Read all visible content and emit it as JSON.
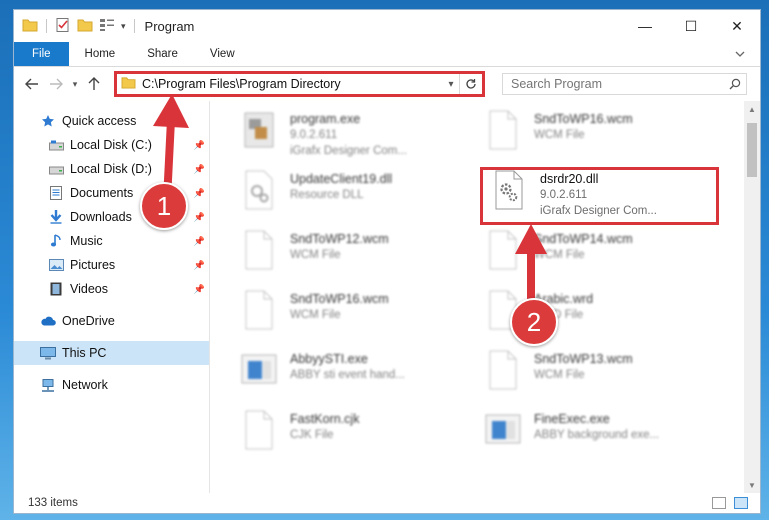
{
  "window": {
    "title": "Program",
    "controls": {
      "minimize": "—",
      "maximize": "☐",
      "close": "✕"
    }
  },
  "ribbon": {
    "tabs": [
      "File",
      "Home",
      "Share",
      "View"
    ],
    "help_icon": "chevron-down-icon"
  },
  "address": {
    "path": "C:\\Program Files\\Program Directory",
    "search_placeholder": "Search Program"
  },
  "sidebar": {
    "items": [
      {
        "label": "Quick access",
        "icon": "star-icon"
      },
      {
        "label": "Local Disk (C:)",
        "icon": "drive-icon",
        "pinned": true
      },
      {
        "label": "Local Disk (D:)",
        "icon": "drive-icon",
        "pinned": true
      },
      {
        "label": "Documents",
        "icon": "documents-icon",
        "pinned": true
      },
      {
        "label": "Downloads",
        "icon": "download-icon",
        "pinned": true
      },
      {
        "label": "Music",
        "icon": "music-icon",
        "pinned": true
      },
      {
        "label": "Pictures",
        "icon": "pictures-icon",
        "pinned": true
      },
      {
        "label": "Videos",
        "icon": "videos-icon",
        "pinned": true
      },
      {
        "label": "OneDrive",
        "icon": "cloud-icon"
      },
      {
        "label": "This PC",
        "icon": "computer-icon",
        "selected": true
      },
      {
        "label": "Network",
        "icon": "network-icon"
      }
    ]
  },
  "files": [
    {
      "name": "program.exe",
      "line2": "9.0.2.611",
      "line3": "iGrafx Designer Com...",
      "icon": "exe-icon"
    },
    {
      "name": "SndToWP16.wcm",
      "line2": "WCM File",
      "line3": "",
      "icon": "file-icon"
    },
    {
      "name": "UpdateClient19.dll",
      "line2": "Resource DLL",
      "line3": "",
      "icon": "dll-icon"
    },
    {
      "name": "dsrdr20.dll",
      "line2": "9.0.2.611",
      "line3": "iGrafx Designer Com...",
      "icon": "dll-gear-icon",
      "highlighted": true
    },
    {
      "name": "SndToWP12.wcm",
      "line2": "WCM File",
      "line3": "",
      "icon": "file-icon"
    },
    {
      "name": "SndToWP14.wcm",
      "line2": "WCM File",
      "line3": "",
      "icon": "file-icon"
    },
    {
      "name": "SndToWP16.wcm",
      "line2": "WCM File",
      "line3": "",
      "icon": "file-icon"
    },
    {
      "name": "Arabic.wrd",
      "line2": "WRD File",
      "line3": "",
      "icon": "file-icon"
    },
    {
      "name": "AbbyySTI.exe",
      "line2": "ABBY sti event hand...",
      "line3": "",
      "icon": "app-icon"
    },
    {
      "name": "SndToWP13.wcm",
      "line2": "WCM File",
      "line3": "",
      "icon": "file-icon"
    },
    {
      "name": "FastKorn.cjk",
      "line2": "CJK File",
      "line3": "",
      "icon": "file-icon"
    },
    {
      "name": "FineExec.exe",
      "line2": "ABBY background exe...",
      "line3": "",
      "icon": "app-icon"
    }
  ],
  "status": {
    "item_count": "133 items"
  },
  "callouts": [
    "1",
    "2"
  ],
  "colors": {
    "accent": "#1979ca",
    "highlight": "#d9343a",
    "selection": "#cce4f7"
  }
}
